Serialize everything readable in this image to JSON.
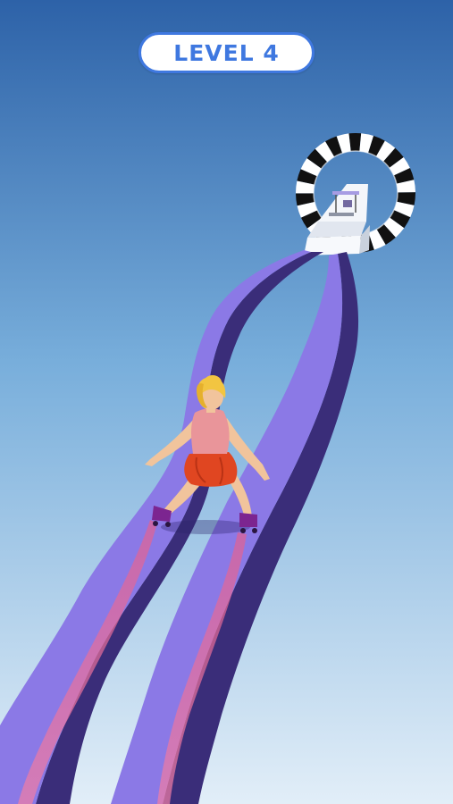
{
  "hud": {
    "level_label": "LEVEL 4"
  },
  "colors": {
    "sky_top": "#2d62a8",
    "sky_bottom": "#e2eef8",
    "track_top": "#8b79e6",
    "track_side": "#3a2d79",
    "trail": "#e4608f",
    "accent": "#3f78e0",
    "finish_ring_dark": "#111111",
    "finish_ring_light": "#ffffff",
    "skater_hair": "#f2c541",
    "skater_top": "#e9959a",
    "skater_skirt": "#e04621",
    "skater_skates": "#7c2590"
  }
}
